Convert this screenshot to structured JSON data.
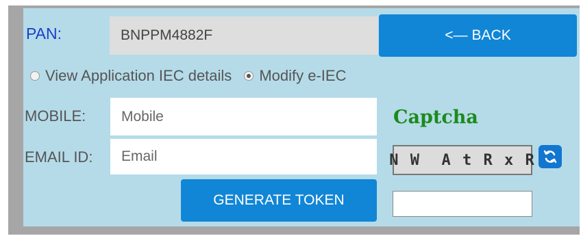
{
  "pan": {
    "label": "PAN:",
    "value": "BNPPM4882F"
  },
  "back_button": {
    "arrow": "<—",
    "label": "BACK"
  },
  "options": [
    {
      "label": "View Application IEC details",
      "selected": false
    },
    {
      "label": "Modify e-IEC",
      "selected": true
    }
  ],
  "mobile": {
    "label": "MOBILE:",
    "placeholder": "Mobile"
  },
  "email": {
    "label": "EMAIL ID:",
    "placeholder": "Email"
  },
  "generate_button": {
    "label": "GENERATE TOKEN"
  },
  "captcha": {
    "title": "Captcha",
    "text": "N W  A t R x R",
    "refresh_icon": "refresh-icon"
  },
  "colors": {
    "panel": "#b5dbe9",
    "button": "#1186d6",
    "captcha_title": "#1c8a1c",
    "pan_label": "#1a3ec8"
  }
}
